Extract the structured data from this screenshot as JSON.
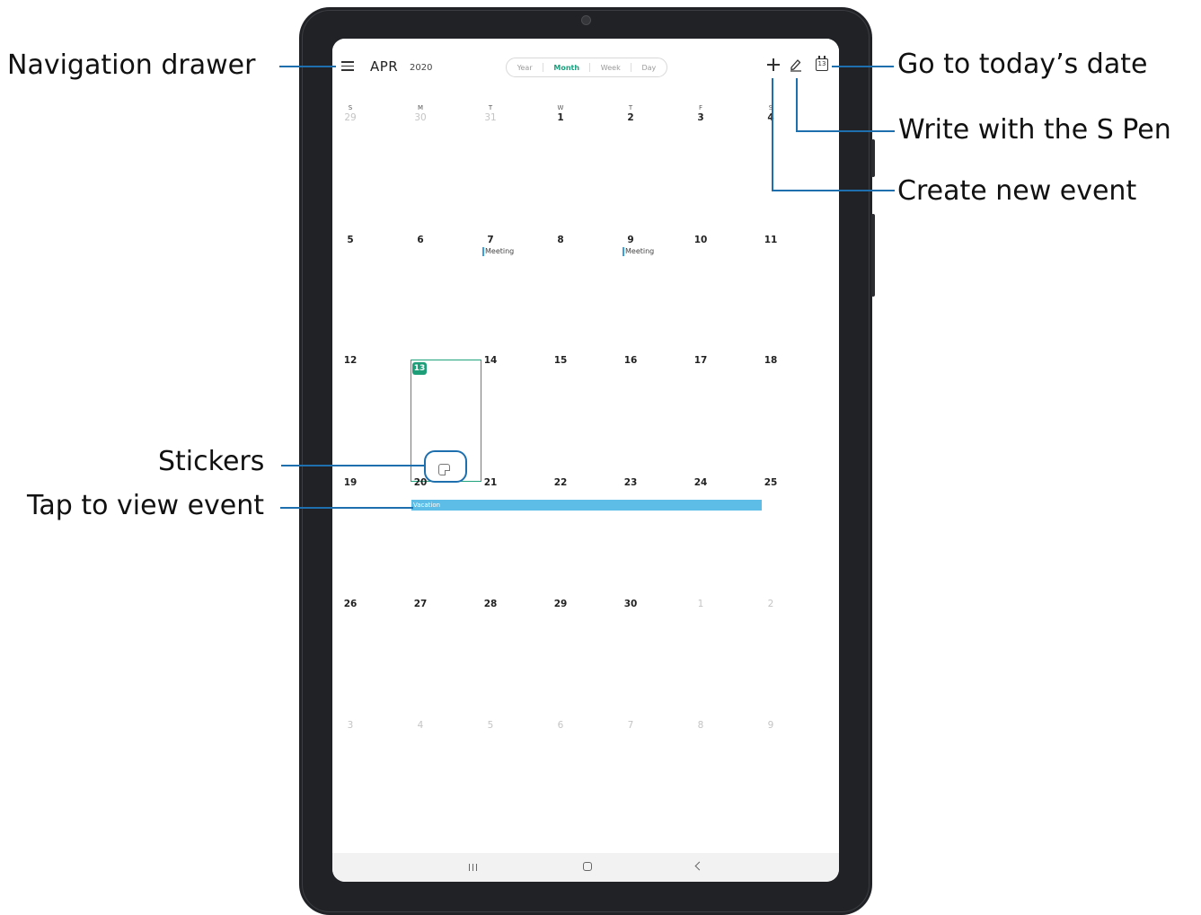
{
  "header": {
    "month": "APR",
    "year": "2020",
    "view_tabs": [
      "Year",
      "Month",
      "Week",
      "Day"
    ],
    "active_tab": "Month",
    "today_icon_number": "13"
  },
  "weekdays": [
    "S",
    "M",
    "T",
    "W",
    "T",
    "F",
    "S"
  ],
  "weeks": [
    [
      {
        "d": "29",
        "muted": true
      },
      {
        "d": "30",
        "muted": true
      },
      {
        "d": "31",
        "muted": true
      },
      {
        "d": "1"
      },
      {
        "d": "2"
      },
      {
        "d": "3"
      },
      {
        "d": "4"
      }
    ],
    [
      {
        "d": "5"
      },
      {
        "d": "6"
      },
      {
        "d": "7",
        "event": "Meeting"
      },
      {
        "d": "8"
      },
      {
        "d": "9",
        "event": "Meeting"
      },
      {
        "d": "10"
      },
      {
        "d": "11"
      }
    ],
    [
      {
        "d": "12"
      },
      {
        "d": "13",
        "today": true
      },
      {
        "d": "14"
      },
      {
        "d": "15"
      },
      {
        "d": "16"
      },
      {
        "d": "17"
      },
      {
        "d": "18"
      }
    ],
    [
      {
        "d": "19"
      },
      {
        "d": "20"
      },
      {
        "d": "21"
      },
      {
        "d": "22"
      },
      {
        "d": "23"
      },
      {
        "d": "24"
      },
      {
        "d": "25"
      }
    ],
    [
      {
        "d": "26"
      },
      {
        "d": "27"
      },
      {
        "d": "28"
      },
      {
        "d": "29"
      },
      {
        "d": "30"
      },
      {
        "d": "1",
        "muted": true
      },
      {
        "d": "2",
        "muted": true
      }
    ],
    [
      {
        "d": "3",
        "muted": true
      },
      {
        "d": "4",
        "muted": true
      },
      {
        "d": "5",
        "muted": true
      },
      {
        "d": "6",
        "muted": true
      },
      {
        "d": "7",
        "muted": true
      },
      {
        "d": "8",
        "muted": true
      },
      {
        "d": "9",
        "muted": true
      }
    ]
  ],
  "vacation_event": "Vacation",
  "callouts": {
    "navigation_drawer": "Navigation drawer",
    "go_to_today": "Go to today’s date",
    "write_with_pen": "Write with the S Pen",
    "create_new_event": "Create new event",
    "stickers": "Stickers",
    "tap_to_view_event": "Tap to view event"
  },
  "colors": {
    "accent_green": "#1e9e78",
    "event_blue": "#5dbde6",
    "callout_line": "#1d6fae",
    "device_frame": "#202226"
  }
}
